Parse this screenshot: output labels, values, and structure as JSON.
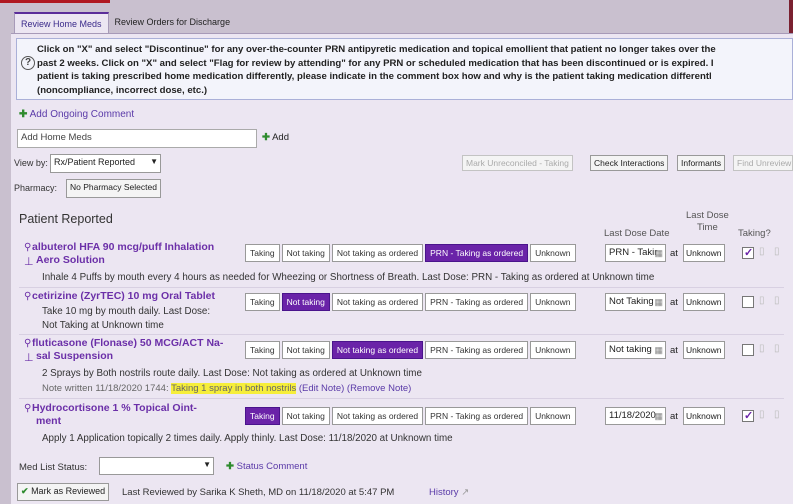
{
  "tabs": [
    {
      "label": "Review Home Meds",
      "active": true
    },
    {
      "label": "Review Orders for Discharge",
      "active": false
    }
  ],
  "info_text": "Click on \"X\" and select \"Discontinue\" for any over-the-counter PRN antipyretic medication and topical emollient that patient no longer takes over the\npast 2 weeks. Click on \"X\" and select \"Flag for review by attending\" for any PRN or scheduled medication that has been discontinued or is expired. I\npatient is taking prescribed home medication differently, please indicate in the comment box how and why is the patient taking medication differentl\n(noncompliance, incorrect dose, etc.)",
  "add_ongoing_comment": "Add Ongoing Comment",
  "add_home_meds": {
    "placeholder": "Add Home Meds",
    "add_label": "Add"
  },
  "view_by": {
    "label": "View by:",
    "value": "Rx/Patient Reported"
  },
  "pharmacy": {
    "label": "Pharmacy:",
    "value": "No Pharmacy Selected"
  },
  "toolbar": {
    "mark_unreconciled": "Mark Unreconciled - Taking",
    "check_interactions": "Check Interactions",
    "informants": "Informants",
    "find_unreviewed": "Find Unreview"
  },
  "section_title": "Patient Reported",
  "columns": {
    "last_dose_date": "Last Dose Date",
    "last_dose_time_line1": "Last Dose",
    "last_dose_time_line2": "Time",
    "taking": "Taking?"
  },
  "status_options": [
    "Taking",
    "Not taking",
    "Not taking as ordered",
    "PRN - Taking as ordered",
    "Unknown"
  ],
  "at_label": "at",
  "meds": [
    {
      "name_line1": "albuterol HFA 90 mcg/puff Inhalation",
      "name_line2": "Aero Solution",
      "sig_line1": "Inhale 4 Puffs by mouth every 4 hours as needed for Wheezing or Shortness of Breath. Last Dose: PRN - Taking as ordered at Unknown time",
      "sig_line2": "",
      "selected_status": "PRN - Taking as ordered",
      "last_dose_date": "PRN - Takir",
      "last_dose_time": "Unknown",
      "taking_checked": true
    },
    {
      "name_line1": "cetirizine (ZyrTEC) 10 mg Oral Tablet",
      "name_line2": "",
      "sig_line1": "Take 10 mg by mouth daily. Last Dose:",
      "sig_line2": "Not Taking at Unknown time",
      "selected_status": "Not taking",
      "last_dose_date": "Not Taking",
      "last_dose_time": "Unknown",
      "taking_checked": false
    },
    {
      "name_line1": "fluticasone (Flonase) 50 MCG/ACT Na-",
      "name_line2": "sal Suspension",
      "sig_line1": "2 Sprays by Both nostrils route daily. Last Dose: Not taking as ordered at Unknown time",
      "sig_line2": "",
      "selected_status": "Not taking as ordered",
      "last_dose_date": "Not taking",
      "last_dose_time": "Unknown",
      "taking_checked": false,
      "note": {
        "prefix": "Note written 11/18/2020 1744:",
        "highlight": "Taking 1 spray in both nostrils",
        "edit": "(Edit Note)",
        "remove": "(Remove Note)"
      }
    },
    {
      "name_line1": "Hydrocortisone 1 % Topical Oint-",
      "name_line2": "ment",
      "sig_line1": "Apply 1 Application topically 2 times daily. Apply thinly. Last Dose: 11/18/2020 at Unknown time",
      "sig_line2": "",
      "selected_status": "Taking",
      "last_dose_date": "11/18/2020",
      "last_dose_time": "Unknown",
      "taking_checked": true
    }
  ],
  "med_list_status": {
    "label": "Med List Status:",
    "value": "",
    "status_comment": "Status Comment"
  },
  "footer": {
    "mark_reviewed": "Mark as Reviewed",
    "last_reviewed": "Last Reviewed by Sarika K Sheth, MD on 11/18/2020 at 5:47 PM",
    "history": "History"
  },
  "colors": {
    "accent_purple": "#6a23a8",
    "link_purple": "#5a3aa8",
    "highlight_yellow": "#f6ee3a",
    "panel_bg": "#ece6f2",
    "outer_bg": "#c9c0cf"
  }
}
